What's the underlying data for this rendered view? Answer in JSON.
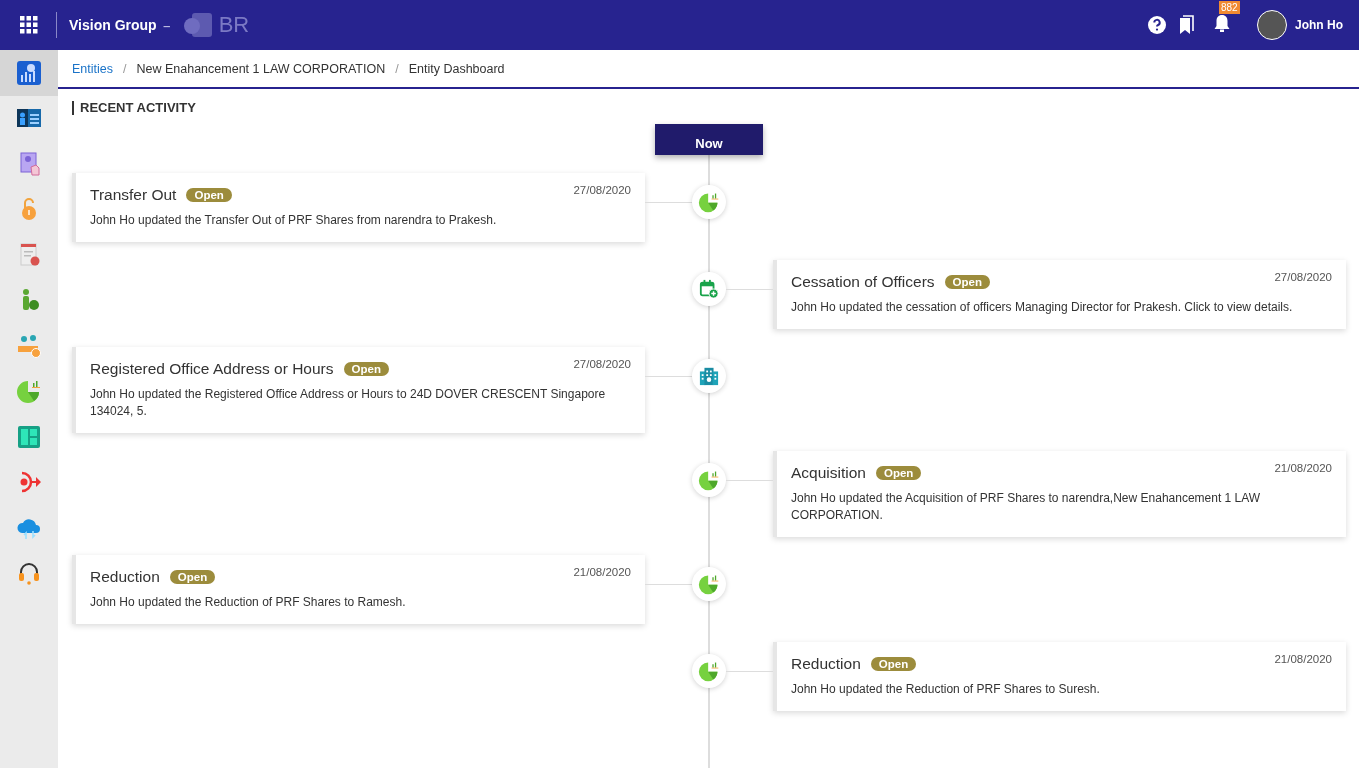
{
  "header": {
    "app_name": "Vision Group",
    "separator": "–",
    "product": "BR",
    "notification_count": "882",
    "user_name": "John Ho"
  },
  "sidebar": {
    "items": [
      {
        "selected": true
      },
      {
        "selected": false
      },
      {
        "selected": false
      },
      {
        "selected": false
      },
      {
        "selected": false
      },
      {
        "selected": false
      },
      {
        "selected": false
      },
      {
        "selected": false
      },
      {
        "selected": false
      },
      {
        "selected": false
      },
      {
        "selected": false
      },
      {
        "selected": false
      }
    ]
  },
  "breadcrumb": [
    {
      "label": "Entities",
      "link": true
    },
    {
      "separator": "/",
      "label": "New Enahancement 1 LAW CORPORATION",
      "link": false
    },
    {
      "separator": "/",
      "label": "Entity Dashboard",
      "link": false
    }
  ],
  "section_title": "RECENT ACTIVITY",
  "timeline": {
    "now_label": "Now",
    "items": [
      {
        "kind": "shares",
        "title": "Transfer Out",
        "status": "Open",
        "date": "27/08/2020",
        "text": "John Ho updated the Transfer Out of PRF Shares from narendra to Prakesh."
      },
      {
        "kind": "officers",
        "title": "Cessation of Officers",
        "status": "Open",
        "date": "27/08/2020",
        "text": "John Ho updated the cessation of officers Managing Director for Prakesh. Click to view details."
      },
      {
        "kind": "address",
        "title": "Registered Office Address or Hours",
        "status": "Open",
        "date": "27/08/2020",
        "text": "John Ho updated the Registered Office Address or Hours to 24D DOVER CRESCENT Singapore 134024, 5."
      },
      {
        "kind": "shares",
        "title": "Acquisition",
        "status": "Open",
        "date": "21/08/2020",
        "text": "John Ho updated the Acquisition of PRF Shares to narendra,New Enahancement 1 LAW CORPORATION."
      },
      {
        "kind": "shares",
        "title": "Reduction",
        "status": "Open",
        "date": "21/08/2020",
        "text": "John Ho updated the Reduction of PRF Shares to Ramesh."
      },
      {
        "kind": "shares",
        "title": "Reduction",
        "status": "Open",
        "date": "21/08/2020",
        "text": "John Ho updated the Reduction of PRF Shares to Suresh."
      }
    ]
  }
}
